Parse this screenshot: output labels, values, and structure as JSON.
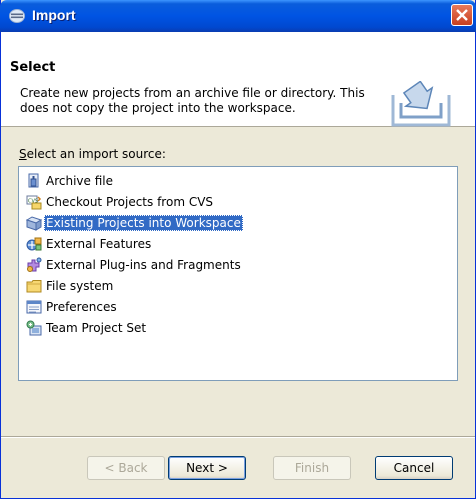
{
  "window": {
    "title": "Import",
    "accent": "#0054e3",
    "close_color": "#c83f1f"
  },
  "banner": {
    "title": "Select",
    "description": "Create new projects from an archive file or directory. This does not copy the project into the workspace.",
    "icon": "import-wizard-icon"
  },
  "source": {
    "label_mnemonic": "S",
    "label_rest": "elect an import source:"
  },
  "tree": {
    "selection_color": "#316ac5",
    "items": [
      {
        "label": "Archive file",
        "icon": "archive-file-icon"
      },
      {
        "label": "Checkout Projects from CVS",
        "icon": "cvs-checkout-icon"
      },
      {
        "label": "Existing Projects into Workspace",
        "icon": "existing-projects-icon",
        "selected": true
      },
      {
        "label": "External Features",
        "icon": "external-features-icon"
      },
      {
        "label": "External Plug-ins and Fragments",
        "icon": "plugins-fragments-icon"
      },
      {
        "label": "File system",
        "icon": "folder-icon"
      },
      {
        "label": "Preferences",
        "icon": "preferences-icon"
      },
      {
        "label": "Team Project Set",
        "icon": "team-project-set-icon"
      }
    ]
  },
  "buttons": {
    "back": "< Back",
    "next": "Next >",
    "finish": "Finish",
    "cancel": "Cancel"
  }
}
